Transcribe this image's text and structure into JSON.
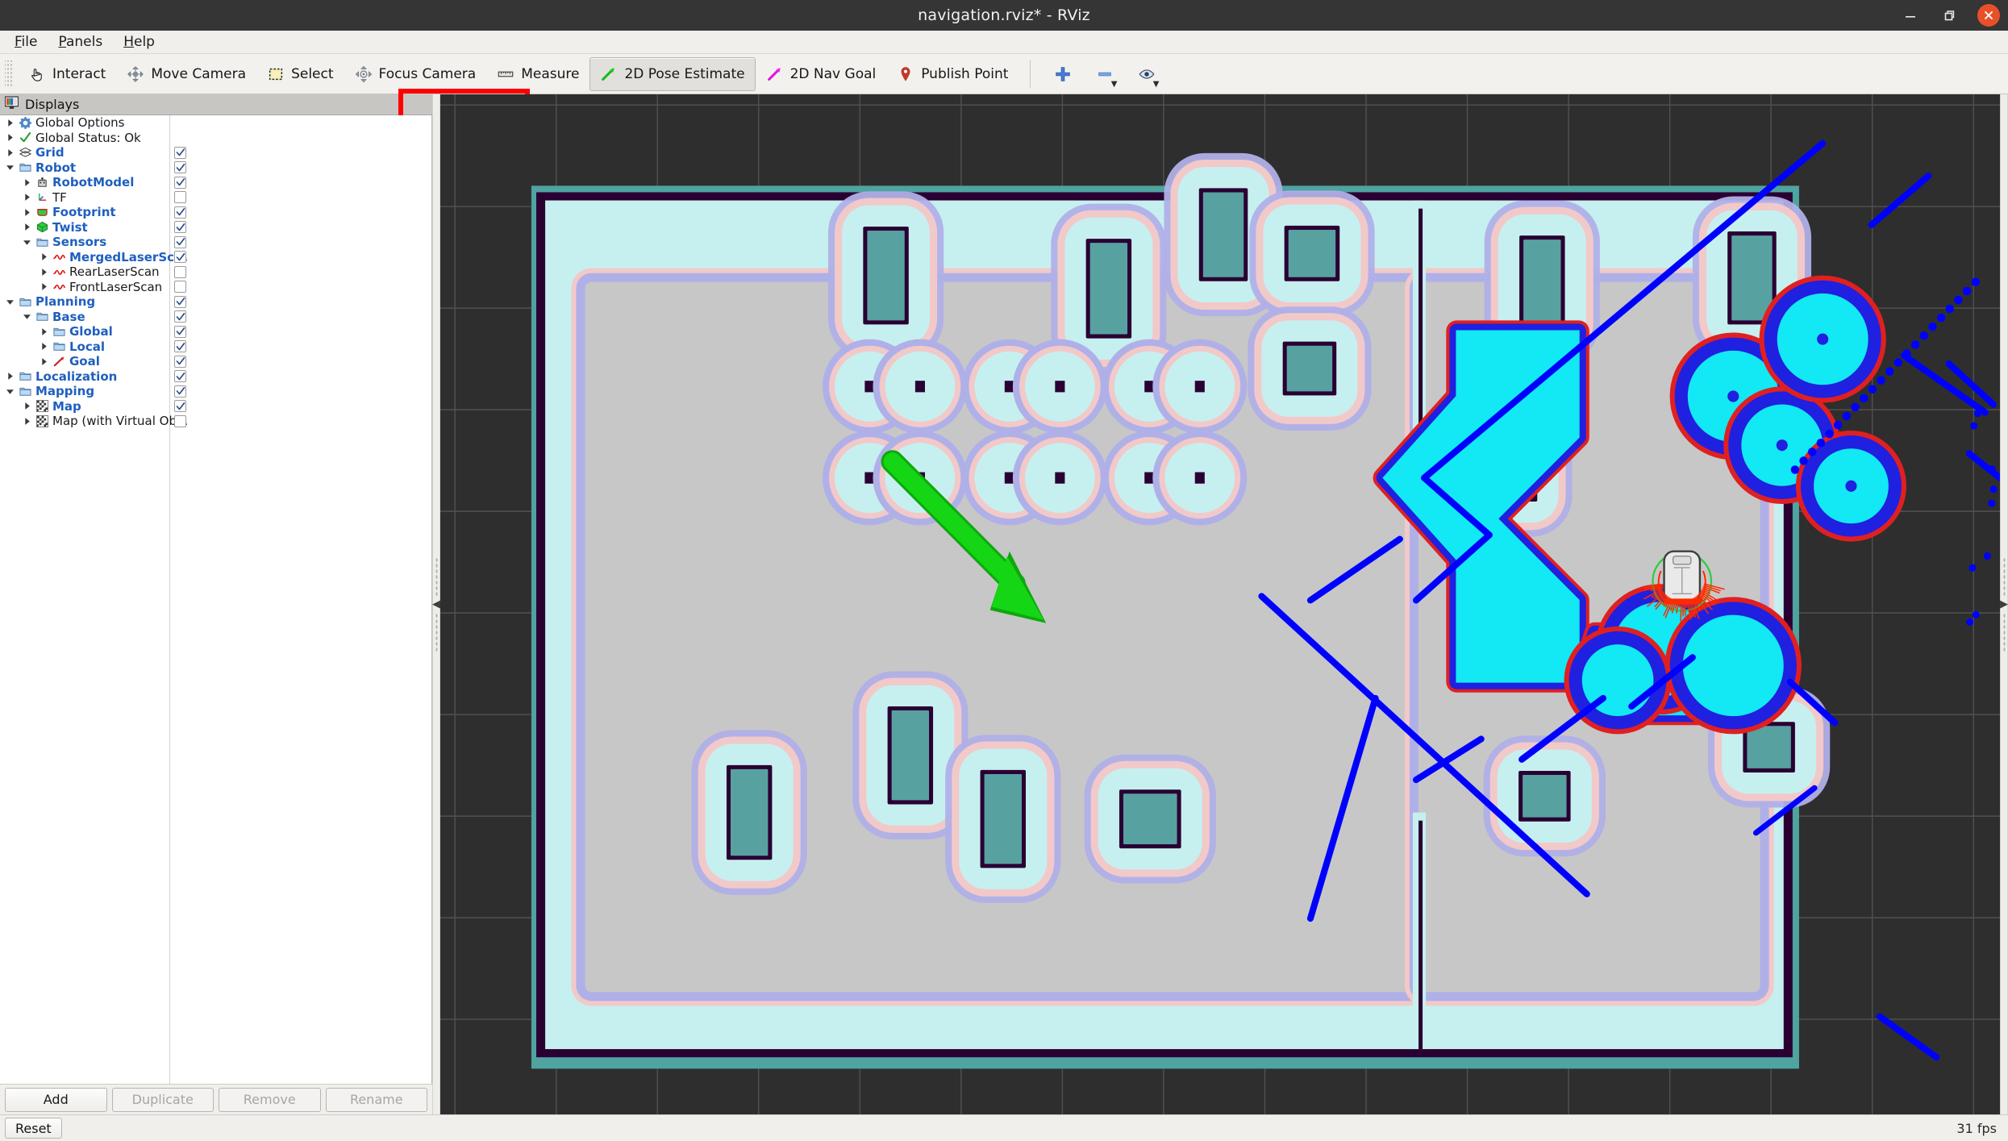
{
  "window": {
    "title": "navigation.rviz* - RViz",
    "minimize_label": "–",
    "maximize_label": "❐",
    "close_label": "✕"
  },
  "menubar": {
    "items": [
      {
        "label": "File",
        "mnemonic": "F"
      },
      {
        "label": "Panels",
        "mnemonic": "P"
      },
      {
        "label": "Help",
        "mnemonic": "H"
      }
    ]
  },
  "toolbar": {
    "tools": [
      {
        "label": "Interact",
        "icon": "hand-pointer-icon",
        "checked": false
      },
      {
        "label": "Move Camera",
        "icon": "move-camera-icon",
        "checked": false
      },
      {
        "label": "Select",
        "icon": "select-rect-icon",
        "checked": false
      },
      {
        "label": "Focus Camera",
        "icon": "focus-camera-icon",
        "checked": false
      },
      {
        "label": "Measure",
        "icon": "ruler-icon",
        "checked": false
      },
      {
        "label": "2D Pose Estimate",
        "icon": "green-arrow-icon",
        "checked": true
      },
      {
        "label": "2D Nav Goal",
        "icon": "magenta-arrow-icon",
        "checked": false
      },
      {
        "label": "Publish Point",
        "icon": "map-pin-icon",
        "checked": false
      }
    ],
    "extra_buttons": [
      {
        "name": "add-tool-button",
        "icon": "plus-icon",
        "has_caret": false
      },
      {
        "name": "remove-tool-button",
        "icon": "minus-icon",
        "has_caret": true
      },
      {
        "name": "visibility-button",
        "icon": "eye-icon",
        "has_caret": true
      }
    ],
    "highlight_color": "#ff0000"
  },
  "displays_panel": {
    "header": "Displays",
    "header_icon": "displays-panel-icon",
    "tree": [
      {
        "label": "Global Options",
        "indent": 0,
        "icon": "gear-icon",
        "arrow": "collapsed",
        "checkbox": "none",
        "bold": false
      },
      {
        "label": "Global Status: Ok",
        "indent": 0,
        "icon": "check-status-icon",
        "arrow": "collapsed",
        "checkbox": "none",
        "bold": false
      },
      {
        "label": "Grid",
        "indent": 0,
        "icon": "grid-icon",
        "arrow": "collapsed",
        "checkbox": "checked",
        "bold": true
      },
      {
        "label": "Robot",
        "indent": 0,
        "icon": "folder-icon",
        "arrow": "expanded",
        "checkbox": "checked",
        "bold": true
      },
      {
        "label": "RobotModel",
        "indent": 1,
        "icon": "robot-icon",
        "arrow": "collapsed",
        "checkbox": "checked",
        "bold": true
      },
      {
        "label": "TF",
        "indent": 1,
        "icon": "tf-axes-icon",
        "arrow": "collapsed",
        "checkbox": "unchecked",
        "bold": false
      },
      {
        "label": "Footprint",
        "indent": 1,
        "icon": "footprint-icon",
        "arrow": "collapsed",
        "checkbox": "checked",
        "bold": true
      },
      {
        "label": "Twist",
        "indent": 1,
        "icon": "twist-cube-icon",
        "arrow": "collapsed",
        "checkbox": "checked",
        "bold": true
      },
      {
        "label": "Sensors",
        "indent": 1,
        "icon": "folder-icon",
        "arrow": "expanded",
        "checkbox": "checked",
        "bold": true
      },
      {
        "label": "MergedLaserSc...",
        "indent": 2,
        "icon": "laserscan-icon",
        "arrow": "collapsed",
        "checkbox": "checked",
        "bold": true
      },
      {
        "label": "RearLaserScan",
        "indent": 2,
        "icon": "laserscan-icon",
        "arrow": "collapsed",
        "checkbox": "unchecked",
        "bold": false
      },
      {
        "label": "FrontLaserScan",
        "indent": 2,
        "icon": "laserscan-icon",
        "arrow": "collapsed",
        "checkbox": "unchecked",
        "bold": false
      },
      {
        "label": "Planning",
        "indent": 0,
        "icon": "folder-icon",
        "arrow": "expanded",
        "checkbox": "checked",
        "bold": true
      },
      {
        "label": "Base",
        "indent": 1,
        "icon": "folder-icon",
        "arrow": "expanded",
        "checkbox": "checked",
        "bold": true
      },
      {
        "label": "Global",
        "indent": 2,
        "icon": "folder-icon",
        "arrow": "collapsed",
        "checkbox": "checked",
        "bold": true
      },
      {
        "label": "Local",
        "indent": 2,
        "icon": "folder-icon",
        "arrow": "collapsed",
        "checkbox": "checked",
        "bold": true
      },
      {
        "label": "Goal",
        "indent": 2,
        "icon": "goal-arrow-icon",
        "arrow": "collapsed",
        "checkbox": "checked",
        "bold": true
      },
      {
        "label": "Localization",
        "indent": 0,
        "icon": "folder-icon",
        "arrow": "collapsed",
        "checkbox": "checked",
        "bold": true
      },
      {
        "label": "Mapping",
        "indent": 0,
        "icon": "folder-icon",
        "arrow": "expanded",
        "checkbox": "checked",
        "bold": true
      },
      {
        "label": "Map",
        "indent": 1,
        "icon": "map-grid-icon",
        "arrow": "collapsed",
        "checkbox": "checked",
        "bold": true
      },
      {
        "label": "Map (with Virtual Ob...",
        "indent": 1,
        "icon": "map-grid-icon",
        "arrow": "collapsed",
        "checkbox": "unchecked",
        "bold": false
      }
    ],
    "buttons": [
      {
        "label": "Add",
        "enabled": true
      },
      {
        "label": "Duplicate",
        "enabled": false
      },
      {
        "label": "Remove",
        "enabled": false
      },
      {
        "label": "Rename",
        "enabled": false
      }
    ]
  },
  "statusbar": {
    "reset_label": "Reset",
    "fps": "31 fps"
  },
  "render_view": {
    "background_color": "#2e2e2e",
    "grid_line_color": "#6e6e6e",
    "map_free_color": "#c7c7c7",
    "map_unknown_color": "#c6f0ef",
    "map_wall_color": "#2a0033",
    "map_border_color": "#4fa3a0",
    "costmap_inflation_mid": "#b0b0e8",
    "costmap_inflation_light": "#f2c9c9",
    "obstacle_fill_color": "#58a1a1",
    "local_costmap_cyan": "#13e8f5",
    "local_costmap_blue": "#2020e0",
    "local_costmap_red": "#e02020",
    "laser_scan_color": "#0000ff",
    "robot_outline_color": "#d8d8d8",
    "footprint_color": "#ff2a00",
    "twist_circle_color": "#2ecc40",
    "pose_arrow_color": "#14d614"
  }
}
